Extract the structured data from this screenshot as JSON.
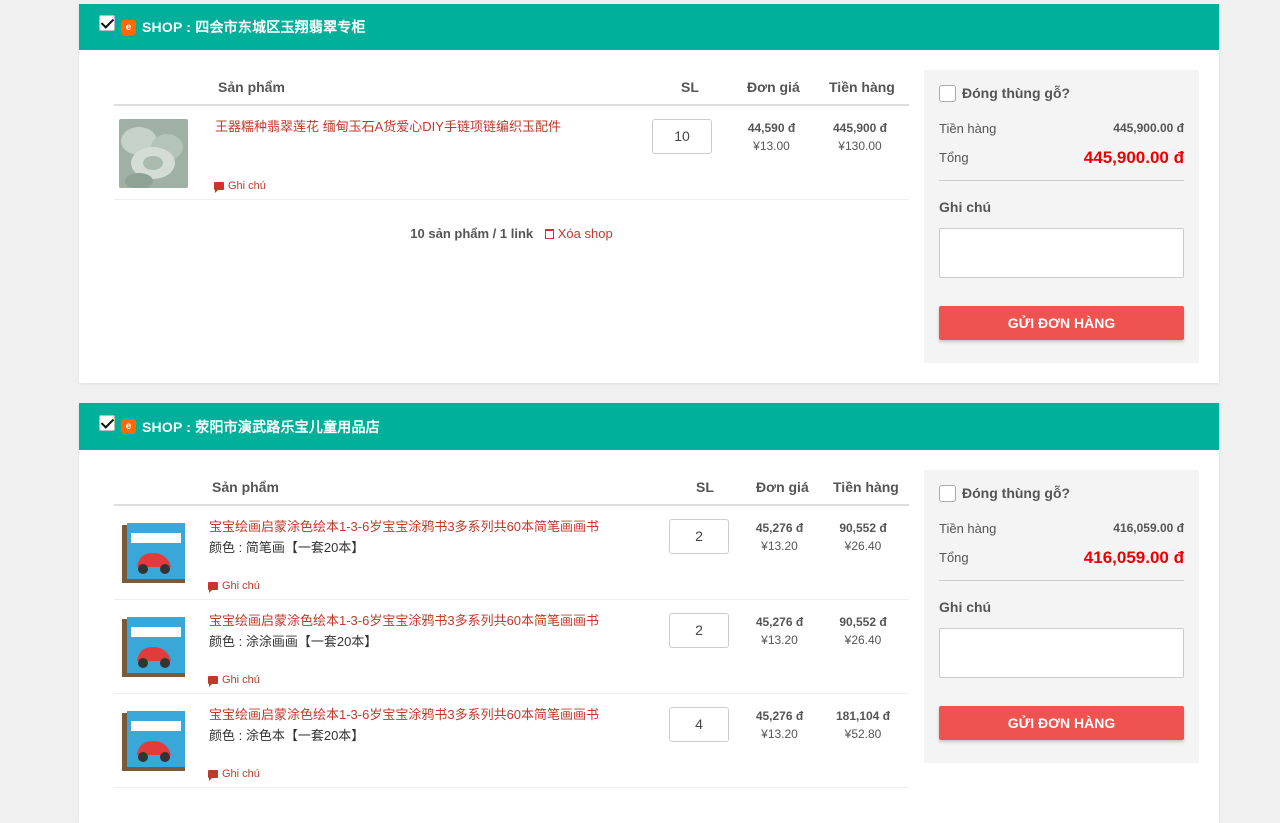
{
  "colors": {
    "header": "#00b09b",
    "accent": "#c0392b",
    "total": "#ee0000",
    "button": "#ef5350"
  },
  "table_headers": {
    "product": "Sản phẩm",
    "qty": "SL",
    "unit_price": "Đơn giá",
    "amount": "Tiền hàng"
  },
  "shops": [
    {
      "prefix": "SHOP :",
      "name": "四会市东城区玉翔翡翠专柜",
      "items": [
        {
          "name": "王器糯种翡翠莲花 缅甸玉石A货爱心DIY手链项链编织玉配件",
          "variant": "",
          "note": "Ghi chú",
          "qty": "10",
          "unit_vnd": "44,590 đ",
          "unit_cny": "¥13.00",
          "amount_vnd": "445,900 đ",
          "amount_cny": "¥130.00"
        }
      ],
      "summary": {
        "count": "10 sản phẩm / 1 link",
        "delete": "Xóa shop"
      },
      "panel": {
        "wood_label": "Đóng thùng gỗ?",
        "subtotal_label": "Tiền hàng",
        "subtotal_value": "445,900.00 đ",
        "total_label": "Tổng",
        "total_value": "445,900.00 đ",
        "note_label": "Ghi chú",
        "send_label": "GỬI ĐƠN HÀNG"
      }
    },
    {
      "prefix": "SHOP :",
      "name": "荥阳市演武路乐宝儿童用品店",
      "items": [
        {
          "name": "宝宝绘画启蒙涂色绘本1-3-6岁宝宝涂鸦书3多系列共60本简笔画画书",
          "variant": "颜色 : 简笔画【一套20本】",
          "note": "Ghi chú",
          "qty": "2",
          "unit_vnd": "45,276 đ",
          "unit_cny": "¥13.20",
          "amount_vnd": "90,552 đ",
          "amount_cny": "¥26.40"
        },
        {
          "name": "宝宝绘画启蒙涂色绘本1-3-6岁宝宝涂鸦书3多系列共60本简笔画画书",
          "variant": "颜色 : 涂涂画画【一套20本】",
          "note": "Ghi chú",
          "qty": "2",
          "unit_vnd": "45,276 đ",
          "unit_cny": "¥13.20",
          "amount_vnd": "90,552 đ",
          "amount_cny": "¥26.40"
        },
        {
          "name": "宝宝绘画启蒙涂色绘本1-3-6岁宝宝涂鸦书3多系列共60本简笔画画书",
          "variant": "颜色 : 涂色本【一套20本】",
          "note": "Ghi chú",
          "qty": "4",
          "unit_vnd": "45,276 đ",
          "unit_cny": "¥13.20",
          "amount_vnd": "181,104 đ",
          "amount_cny": "¥52.80"
        }
      ],
      "panel": {
        "wood_label": "Đóng thùng gỗ?",
        "subtotal_label": "Tiền hàng",
        "subtotal_value": "416,059.00 đ",
        "total_label": "Tổng",
        "total_value": "416,059.00 đ",
        "note_label": "Ghi chú",
        "send_label": "GỬI ĐƠN HÀNG"
      }
    }
  ]
}
